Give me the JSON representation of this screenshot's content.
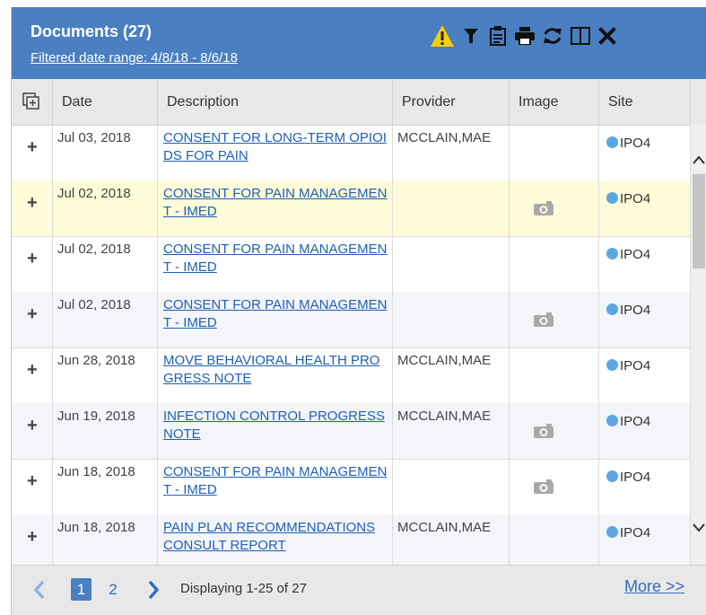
{
  "header": {
    "title": "Documents (27)",
    "filter_text": "Filtered date range: 4/8/18 - 8/6/18",
    "tools": [
      "warning-icon",
      "filter-icon",
      "clipboard-icon",
      "print-icon",
      "refresh-icon",
      "columns-icon",
      "close-icon"
    ]
  },
  "columns": [
    "Date",
    "Description",
    "Provider",
    "Image",
    "Site"
  ],
  "rows": [
    {
      "date": "Jul 03, 2018",
      "desc": "CONSENT FOR LONG-TERM OPIOIDS FOR PAIN",
      "provider": "MCCLAIN,MAE",
      "image": false,
      "site": "IPO4"
    },
    {
      "date": "Jul 02, 2018",
      "desc": "CONSENT FOR PAIN MANAGEMENT - IMED",
      "provider": "",
      "image": true,
      "site": "IPO4"
    },
    {
      "date": "Jul 02, 2018",
      "desc": "CONSENT FOR PAIN MANAGEMENT - IMED",
      "provider": "",
      "image": false,
      "site": "IPO4"
    },
    {
      "date": "Jul 02, 2018",
      "desc": "CONSENT FOR PAIN MANAGEMENT - IMED",
      "provider": "",
      "image": true,
      "site": "IPO4"
    },
    {
      "date": "Jun 28, 2018",
      "desc": "MOVE BEHAVIORAL HEALTH PROGRESS NOTE",
      "provider": "MCCLAIN,MAE",
      "image": false,
      "site": "IPO4"
    },
    {
      "date": "Jun 19, 2018",
      "desc": "INFECTION CONTROL PROGRESS NOTE",
      "provider": "MCCLAIN,MAE",
      "image": true,
      "site": "IPO4"
    },
    {
      "date": "Jun 18, 2018",
      "desc": "CONSENT FOR PAIN MANAGEMENT - IMED",
      "provider": "",
      "image": true,
      "site": "IPO4"
    },
    {
      "date": "Jun 18, 2018",
      "desc": "PAIN PLAN RECOMMENDATIONS CONSULT REPORT",
      "provider": "MCCLAIN,MAE",
      "image": false,
      "site": "IPO4"
    }
  ],
  "pagination": {
    "current": "1",
    "next_page": "2",
    "display_text": "Displaying 1-25 of 27",
    "more": "More >>"
  },
  "colors": {
    "header_bg": "#4a7fc1",
    "link": "#1f5fb9",
    "selected_row": "#fefbd8",
    "site_dot": "#5ba7e2",
    "warning": "#f5d000"
  }
}
